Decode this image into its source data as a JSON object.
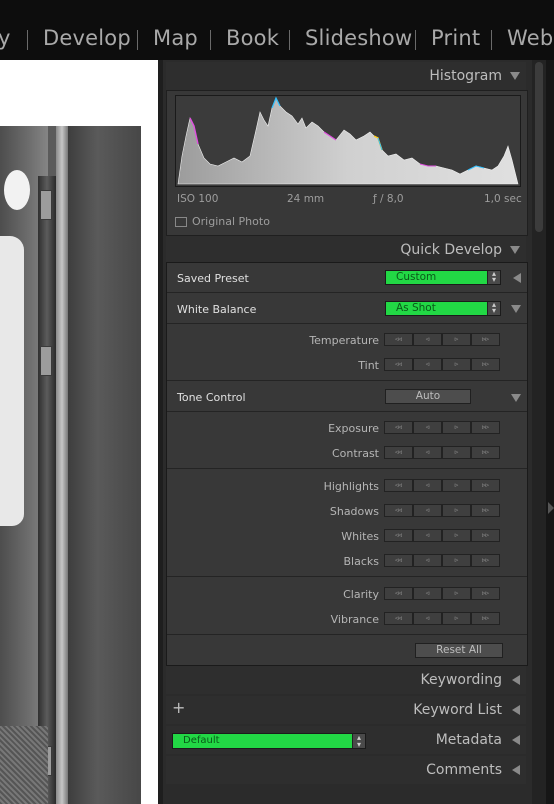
{
  "modules": [
    "y",
    "Develop",
    "Map",
    "Book",
    "Slideshow",
    "Print",
    "Web"
  ],
  "histogram": {
    "title": "Histogram",
    "iso": "ISO 100",
    "focal_length": "24 mm",
    "aperture": "ƒ / 8,0",
    "shutter": "1,0 sec",
    "original_photo_label": "Original Photo"
  },
  "quick_develop": {
    "title": "Quick Develop",
    "saved_preset_label": "Saved Preset",
    "saved_preset_value": "Custom",
    "white_balance_label": "White Balance",
    "white_balance_value": "As Shot",
    "temperature": "Temperature",
    "tint": "Tint",
    "tone_control_label": "Tone Control",
    "auto_label": "Auto",
    "exposure": "Exposure",
    "contrast": "Contrast",
    "highlights": "Highlights",
    "shadows": "Shadows",
    "whites": "Whites",
    "blacks": "Blacks",
    "clarity": "Clarity",
    "vibrance": "Vibrance",
    "reset_all": "Reset All"
  },
  "stepper_glyphs": [
    "◃◃",
    "◃",
    "▹",
    "▹▹"
  ],
  "keywording": "Keywording",
  "keyword_list": "Keyword List",
  "keyword_list_plus": "+",
  "metadata": {
    "title": "Metadata",
    "preset": "Default"
  },
  "comments": "Comments",
  "colors": {
    "accent_green": "#22d845",
    "panel_bg": "#383838",
    "topbar_bg": "#0d0d0d"
  }
}
